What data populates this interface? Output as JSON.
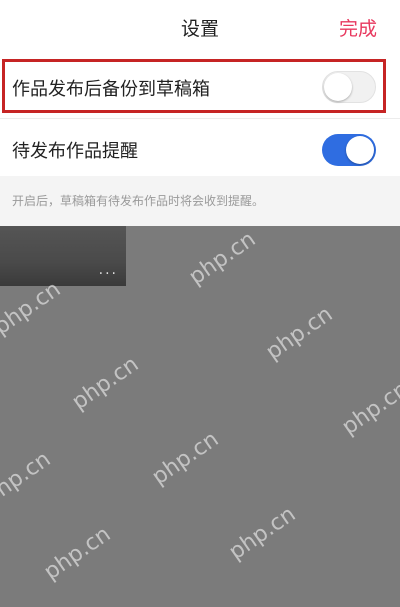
{
  "header": {
    "title": "设置",
    "done_label": "完成"
  },
  "settings": {
    "backup_label": "作品发布后备份到草稿箱",
    "backup_enabled": false,
    "reminder_label": "待发布作品提醒",
    "reminder_enabled": true,
    "hint": "开启后，草稿箱有待发布作品时将会收到提醒。"
  },
  "overlay": {
    "thumb_dots": "...",
    "watermark": "php.cn"
  },
  "colors": {
    "accent": "#e8395f",
    "toggle_on": "#2f6de1",
    "highlight": "#c62424"
  }
}
